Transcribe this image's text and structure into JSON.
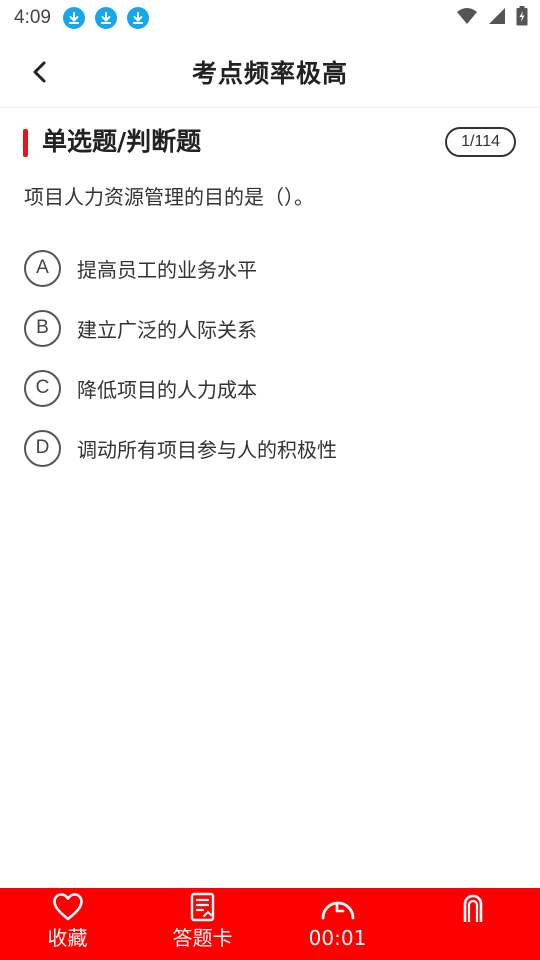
{
  "status_bar": {
    "time": "4:09",
    "notification_icons": [
      "download-icon",
      "download-icon",
      "download-icon"
    ],
    "right_icons": [
      "wifi-icon",
      "signal-icon",
      "battery-charging-icon"
    ]
  },
  "header": {
    "title": "考点频率极高",
    "back_icon": "chevron-left-icon"
  },
  "section": {
    "title": "单选题/判断题",
    "progress": "1/114"
  },
  "question": {
    "text": "项目人力资源管理的目的是（）。",
    "options": [
      {
        "letter": "A",
        "text": "提高员工的业务水平"
      },
      {
        "letter": "B",
        "text": "建立广泛的人际关系"
      },
      {
        "letter": "C",
        "text": "降低项目的人力成本"
      },
      {
        "letter": "D",
        "text": "调动所有项目参与人的积极性"
      }
    ]
  },
  "bottom_bar": {
    "items": [
      {
        "icon": "heart-icon",
        "label": "收藏"
      },
      {
        "icon": "answer-sheet-icon",
        "label": "答题卡"
      },
      {
        "icon": "timer-icon",
        "label": "00:01"
      },
      {
        "icon": "hand-icon",
        "label": ""
      }
    ]
  },
  "colors": {
    "accent": "#e5161b",
    "bottom_bar": "#fe0000",
    "download_badge": "#16a6ec"
  }
}
